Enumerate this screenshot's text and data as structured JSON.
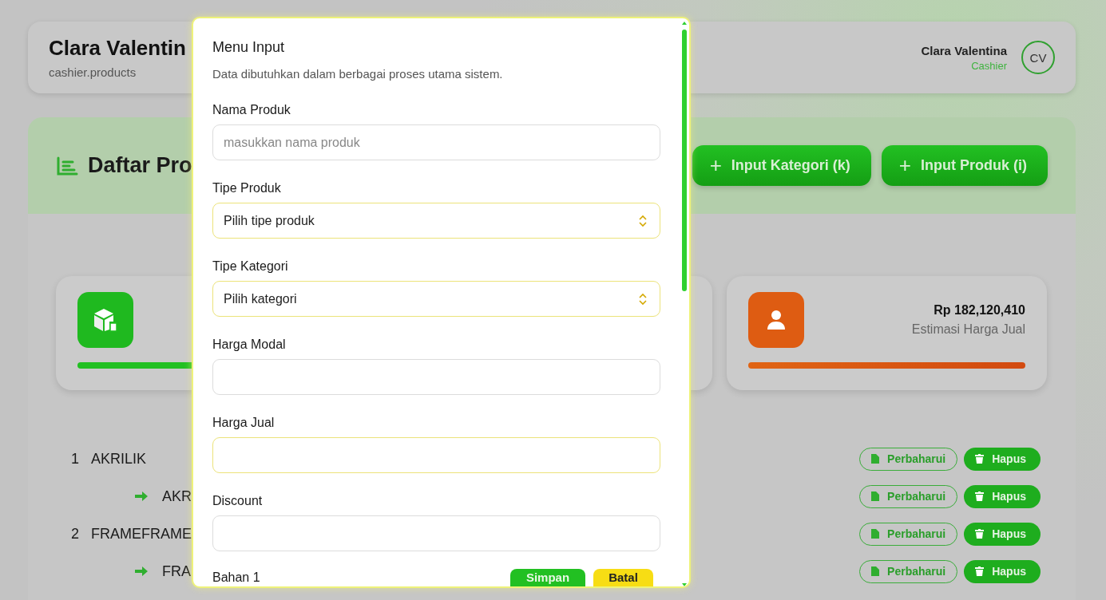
{
  "header": {
    "title": "Clara Valentin",
    "subtitle": "cashier.products",
    "user_name": "Clara Valentina",
    "user_role": "Cashier",
    "avatar_initials": "CV"
  },
  "section": {
    "title": "Daftar Pro",
    "buttons": [
      {
        "icon": "+",
        "label": "Input Kategori (k)"
      },
      {
        "icon": "+",
        "label": "Input Produk (i)"
      }
    ]
  },
  "stat_cards": [
    {
      "kind": "product"
    },
    {
      "kind": "person",
      "value": "Rp 182,120,410",
      "caption": "Estimasi Harga Jual"
    }
  ],
  "rows": [
    {
      "kind": "parent",
      "number": "1",
      "name": "AKRILIK",
      "update_label": "Perbaharui",
      "delete_label": "Hapus"
    },
    {
      "kind": "child",
      "name": "AKR",
      "update_label": "Perbaharui",
      "delete_label": "Hapus"
    },
    {
      "kind": "parent",
      "number": "2",
      "name": "FRAMEFRAME",
      "update_label": "Perbaharui",
      "delete_label": "Hapus"
    },
    {
      "kind": "child",
      "name": "FRA",
      "update_label": "Perbaharui",
      "delete_label": "Hapus"
    }
  ],
  "modal": {
    "title": "Menu Input",
    "description": "Data dibutuhkan dalam berbagai proses utama sistem.",
    "fields": [
      {
        "label": "Nama Produk",
        "kind": "text",
        "placeholder": "masukkan nama produk",
        "highlighted": false
      },
      {
        "label": "Tipe Produk",
        "kind": "select",
        "value": "Pilih tipe produk",
        "highlighted": true
      },
      {
        "label": "Tipe Kategori",
        "kind": "select",
        "value": "Pilih kategori",
        "highlighted": true
      },
      {
        "label": "Harga Modal",
        "kind": "text",
        "highlighted": false
      },
      {
        "label": "Harga Jual",
        "kind": "text",
        "highlighted": true
      },
      {
        "label": "Discount",
        "kind": "text",
        "highlighted": false
      }
    ],
    "next_label": "Bahan 1",
    "save_label": "Simpan",
    "cancel_label": "Batal"
  }
}
